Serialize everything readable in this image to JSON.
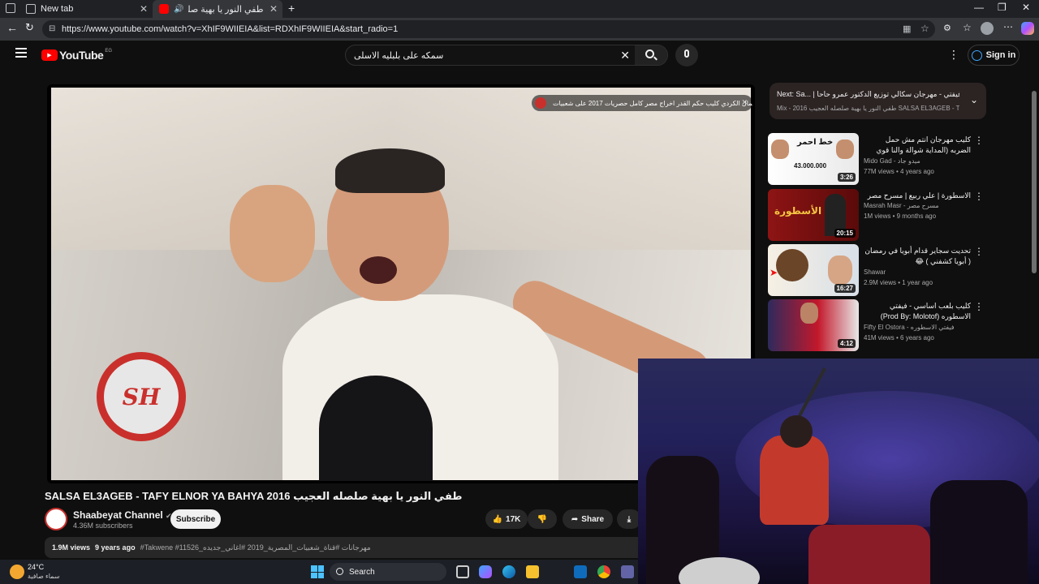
{
  "browser": {
    "tabs": [
      {
        "label": "New tab"
      },
      {
        "label": "طفي النور يا بهية صلصله الع"
      }
    ],
    "url": "https://www.youtube.com/watch?v=XhIF9WIIEIA&list=RDXhIF9WIIEIA&start_radio=1"
  },
  "youtube": {
    "logo": "YouTube",
    "region": "EG",
    "search_query": "سمكه على بلبليه الاسلى",
    "sign_in": "Sign in"
  },
  "player": {
    "overlay_title": "جمال الكردي كليب حكم القدر اخراج مصر كامل حصريات 2017 على شعبيات ...lkadar",
    "logo_text": "SH"
  },
  "video": {
    "title": "SALSA EL3AGEB - TAFY ELNOR YA BAHYA طفي النور يا بهية صلصله العجيب 2016",
    "channel": "Shaabeyat Channel",
    "subscribers": "4.36M subscribers",
    "subscribe": "Subscribe",
    "likes": "17K",
    "share": "Share",
    "views": "1.9M views",
    "age": "9 years ago",
    "tags": "#Takwene #مهرجانات #قناة_شعبيات_المصرية_2019 #اغاني_جديده_11526",
    "tag_first": "#Takwene"
  },
  "up_next": {
    "line1": "Next: Sa... | سادات و فيفتي - مهرجان سكالي توزيع الدكتور عمرو حاحا",
    "line2": "Mix - طفي النور يا بهية صلصله العجيب 2016 SALSA EL3AGEB - TAFY ..."
  },
  "recommendations": [
    {
      "title": "كليب مهرجان انتم مش حمل الضربه (المداية شوالة والنا قوي مفيا) مينو جاد وبيكا و توزيع",
      "channel": "Mido Gad - ميدو جاد",
      "meta": "77M views • 4 years ago",
      "duration": "3:26",
      "thumb_text": "43.000.000"
    },
    {
      "title": "الاسطورة | علي ربيع | مسرح مصر",
      "channel": "Masrah Masr - مسرح مصر",
      "meta": "1M views • 9 months ago",
      "duration": "20:15",
      "thumb_text": "الأسطورة"
    },
    {
      "title": "تحديت سجاير قدام أبويا في رمضان ( أبويا كشفني ) 😂",
      "channel": "Shawar",
      "meta": "2.9M views • 1 year ago",
      "duration": "16:27",
      "thumb_text": ""
    },
    {
      "title": "كليب بلعب اساسي - فيفتي الاسطوره (Prod By: Molotof)",
      "channel": "Fifty El Ostora - فيفتي الاسطوره",
      "meta": "41M views • 6 years ago",
      "duration": "4:12",
      "thumb_text": ""
    }
  ],
  "taskbar": {
    "temp": "24°C",
    "weather": "سماء صافية",
    "search": "Search"
  },
  "colors": {
    "accent": "#3ea6ff",
    "brand_red": "#ff0000",
    "bg": "#0f0f0f"
  }
}
